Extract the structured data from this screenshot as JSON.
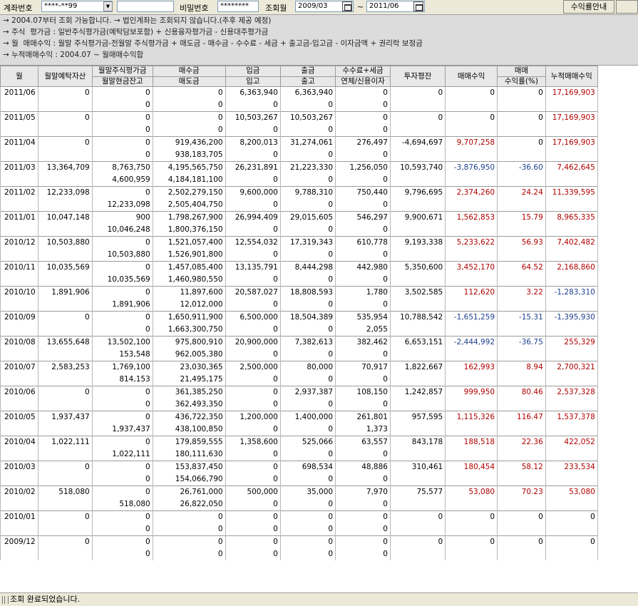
{
  "toolbar": {
    "account_label": "계좌번호",
    "account_value": "****-**99",
    "account_name_value": "",
    "password_label": "비밀번호",
    "password_value": "********",
    "query_month_label": "조회월",
    "from_month": "2009/03",
    "range_sep": "~",
    "to_month": "2011/06",
    "guide_button": "수익률안내"
  },
  "info_lines": [
    "→ 2004.07부터 조회 가능합니다. → 법인계좌는 조회되지 않습니다.(추후 제공 예정)",
    "→ 주식  평가금 : 일반주식평가금(예탁담보포함) + 신용융자평가금 - 신용대주평가금",
    "→ 월  매매수익 : 월말 주식평가금-전월말 주식평가금 + 매도금 - 매수금 - 수수료 - 세금 + 출고금-입고금 - 이자금액 + 권리락 보정금",
    "→ 누적매매수익 : 2004.07 ~ 월매매수익합"
  ],
  "columns": {
    "month": "월",
    "deposit": "월말예탁자산",
    "stock_eval_top": "월말주식평가금",
    "stock_eval_bottom": "월말현금잔고",
    "buy_top": "매수금",
    "buy_bottom": "매도금",
    "in_top": "입금",
    "in_bottom": "입고",
    "out_top": "출금",
    "out_bottom": "출고",
    "fee_top": "수수료+세금",
    "fee_bottom": "연체/신용이자",
    "avg_invest": "투자평잔",
    "trade_profit": "매매수익",
    "rate_top": "매매",
    "rate_bottom": "수익률(%)",
    "cum_profit": "누적매매수익"
  },
  "rows": [
    {
      "month": "2011/06",
      "deposit": "0",
      "stock_eval": "0",
      "cash": "0",
      "buy": "0",
      "sell": "0",
      "deposit_in": "6,363,940",
      "stock_in": "0",
      "withdraw": "6,363,940",
      "stock_out": "0",
      "fee": "0",
      "interest": "0",
      "avg_invest": "0",
      "profit": "0",
      "rate": "0",
      "cum": "17,169,903",
      "profit_color": "black",
      "rate_color": "black",
      "cum_color": "red"
    },
    {
      "month": "2011/05",
      "deposit": "0",
      "stock_eval": "0",
      "cash": "0",
      "buy": "0",
      "sell": "0",
      "deposit_in": "10,503,267",
      "stock_in": "0",
      "withdraw": "10,503,267",
      "stock_out": "0",
      "fee": "0",
      "interest": "0",
      "avg_invest": "0",
      "profit": "0",
      "rate": "0",
      "cum": "17,169,903",
      "profit_color": "black",
      "rate_color": "black",
      "cum_color": "red"
    },
    {
      "month": "2011/04",
      "deposit": "0",
      "stock_eval": "0",
      "cash": "0",
      "buy": "919,436,200",
      "sell": "938,183,705",
      "deposit_in": "8,200,013",
      "stock_in": "0",
      "withdraw": "31,274,061",
      "stock_out": "0",
      "fee": "276,497",
      "interest": "0",
      "avg_invest": "-4,694,697",
      "profit": "9,707,258",
      "rate": "0",
      "cum": "17,169,903",
      "profit_color": "red",
      "rate_color": "black",
      "cum_color": "red"
    },
    {
      "month": "2011/03",
      "deposit": "13,364,709",
      "stock_eval": "8,763,750",
      "cash": "4,600,959",
      "buy": "4,195,565,750",
      "sell": "4,184,181,100",
      "deposit_in": "26,231,891",
      "stock_in": "0",
      "withdraw": "21,223,330",
      "stock_out": "0",
      "fee": "1,256,050",
      "interest": "0",
      "avg_invest": "10,593,740",
      "profit": "-3,876,950",
      "rate": "-36.60",
      "cum": "7,462,645",
      "profit_color": "blue",
      "rate_color": "blue",
      "cum_color": "red"
    },
    {
      "month": "2011/02",
      "deposit": "12,233,098",
      "stock_eval": "0",
      "cash": "12,233,098",
      "buy": "2,502,279,150",
      "sell": "2,505,404,750",
      "deposit_in": "9,600,000",
      "stock_in": "0",
      "withdraw": "9,788,310",
      "stock_out": "0",
      "fee": "750,440",
      "interest": "0",
      "avg_invest": "9,796,695",
      "profit": "2,374,260",
      "rate": "24.24",
      "cum": "11,339,595",
      "profit_color": "red",
      "rate_color": "red",
      "cum_color": "red"
    },
    {
      "month": "2011/01",
      "deposit": "10,047,148",
      "stock_eval": "900",
      "cash": "10,046,248",
      "buy": "1,798,267,900",
      "sell": "1,800,376,150",
      "deposit_in": "26,994,409",
      "stock_in": "0",
      "withdraw": "29,015,605",
      "stock_out": "0",
      "fee": "546,297",
      "interest": "0",
      "avg_invest": "9,900,671",
      "profit": "1,562,853",
      "rate": "15.79",
      "cum": "8,965,335",
      "profit_color": "red",
      "rate_color": "red",
      "cum_color": "red"
    },
    {
      "month": "2010/12",
      "deposit": "10,503,880",
      "stock_eval": "0",
      "cash": "10,503,880",
      "buy": "1,521,057,400",
      "sell": "1,526,901,800",
      "deposit_in": "12,554,032",
      "stock_in": "0",
      "withdraw": "17,319,343",
      "stock_out": "0",
      "fee": "610,778",
      "interest": "0",
      "avg_invest": "9,193,338",
      "profit": "5,233,622",
      "rate": "56.93",
      "cum": "7,402,482",
      "profit_color": "red",
      "rate_color": "red",
      "cum_color": "red"
    },
    {
      "month": "2010/11",
      "deposit": "10,035,569",
      "stock_eval": "0",
      "cash": "10,035,569",
      "buy": "1,457,085,400",
      "sell": "1,460,980,550",
      "deposit_in": "13,135,791",
      "stock_in": "0",
      "withdraw": "8,444,298",
      "stock_out": "0",
      "fee": "442,980",
      "interest": "0",
      "avg_invest": "5,350,600",
      "profit": "3,452,170",
      "rate": "64.52",
      "cum": "2,168,860",
      "profit_color": "red",
      "rate_color": "red",
      "cum_color": "red"
    },
    {
      "month": "2010/10",
      "deposit": "1,891,906",
      "stock_eval": "0",
      "cash": "1,891,906",
      "buy": "11,897,600",
      "sell": "12,012,000",
      "deposit_in": "20,587,027",
      "stock_in": "0",
      "withdraw": "18,808,593",
      "stock_out": "0",
      "fee": "1,780",
      "interest": "0",
      "avg_invest": "3,502,585",
      "profit": "112,620",
      "rate": "3.22",
      "cum": "-1,283,310",
      "profit_color": "red",
      "rate_color": "red",
      "cum_color": "blue"
    },
    {
      "month": "2010/09",
      "deposit": "0",
      "stock_eval": "0",
      "cash": "0",
      "buy": "1,650,911,900",
      "sell": "1,663,300,750",
      "deposit_in": "6,500,000",
      "stock_in": "0",
      "withdraw": "18,504,389",
      "stock_out": "0",
      "fee": "535,954",
      "interest": "2,055",
      "avg_invest": "10,788,542",
      "profit": "-1,651,259",
      "rate": "-15.31",
      "cum": "-1,395,930",
      "profit_color": "blue",
      "rate_color": "blue",
      "cum_color": "blue"
    },
    {
      "month": "2010/08",
      "deposit": "13,655,648",
      "stock_eval": "13,502,100",
      "cash": "153,548",
      "buy": "975,800,910",
      "sell": "962,005,380",
      "deposit_in": "20,900,000",
      "stock_in": "0",
      "withdraw": "7,382,613",
      "stock_out": "0",
      "fee": "382,462",
      "interest": "0",
      "avg_invest": "6,653,151",
      "profit": "-2,444,992",
      "rate": "-36.75",
      "cum": "255,329",
      "profit_color": "blue",
      "rate_color": "blue",
      "cum_color": "red"
    },
    {
      "month": "2010/07",
      "deposit": "2,583,253",
      "stock_eval": "1,769,100",
      "cash": "814,153",
      "buy": "23,030,365",
      "sell": "21,495,175",
      "deposit_in": "2,500,000",
      "stock_in": "0",
      "withdraw": "80,000",
      "stock_out": "0",
      "fee": "70,917",
      "interest": "0",
      "avg_invest": "1,822,667",
      "profit": "162,993",
      "rate": "8.94",
      "cum": "2,700,321",
      "profit_color": "red",
      "rate_color": "red",
      "cum_color": "red"
    },
    {
      "month": "2010/06",
      "deposit": "0",
      "stock_eval": "0",
      "cash": "0",
      "buy": "361,385,250",
      "sell": "362,493,350",
      "deposit_in": "0",
      "stock_in": "0",
      "withdraw": "2,937,387",
      "stock_out": "0",
      "fee": "108,150",
      "interest": "0",
      "avg_invest": "1,242,857",
      "profit": "999,950",
      "rate": "80.46",
      "cum": "2,537,328",
      "profit_color": "red",
      "rate_color": "red",
      "cum_color": "red"
    },
    {
      "month": "2010/05",
      "deposit": "1,937,437",
      "stock_eval": "0",
      "cash": "1,937,437",
      "buy": "436,722,350",
      "sell": "438,100,850",
      "deposit_in": "1,200,000",
      "stock_in": "0",
      "withdraw": "1,400,000",
      "stock_out": "0",
      "fee": "261,801",
      "interest": "1,373",
      "avg_invest": "957,595",
      "profit": "1,115,326",
      "rate": "116.47",
      "cum": "1,537,378",
      "profit_color": "red",
      "rate_color": "red",
      "cum_color": "red"
    },
    {
      "month": "2010/04",
      "deposit": "1,022,111",
      "stock_eval": "0",
      "cash": "1,022,111",
      "buy": "179,859,555",
      "sell": "180,111,630",
      "deposit_in": "1,358,600",
      "stock_in": "0",
      "withdraw": "525,066",
      "stock_out": "0",
      "fee": "63,557",
      "interest": "0",
      "avg_invest": "843,178",
      "profit": "188,518",
      "rate": "22.36",
      "cum": "422,052",
      "profit_color": "red",
      "rate_color": "red",
      "cum_color": "red"
    },
    {
      "month": "2010/03",
      "deposit": "0",
      "stock_eval": "0",
      "cash": "0",
      "buy": "153,837,450",
      "sell": "154,066,790",
      "deposit_in": "0",
      "stock_in": "0",
      "withdraw": "698,534",
      "stock_out": "0",
      "fee": "48,886",
      "interest": "0",
      "avg_invest": "310,461",
      "profit": "180,454",
      "rate": "58.12",
      "cum": "233,534",
      "profit_color": "red",
      "rate_color": "red",
      "cum_color": "red"
    },
    {
      "month": "2010/02",
      "deposit": "518,080",
      "stock_eval": "0",
      "cash": "518,080",
      "buy": "26,761,000",
      "sell": "26,822,050",
      "deposit_in": "500,000",
      "stock_in": "0",
      "withdraw": "35,000",
      "stock_out": "0",
      "fee": "7,970",
      "interest": "0",
      "avg_invest": "75,577",
      "profit": "53,080",
      "rate": "70.23",
      "cum": "53,080",
      "profit_color": "red",
      "rate_color": "red",
      "cum_color": "red"
    },
    {
      "month": "2010/01",
      "deposit": "0",
      "stock_eval": "0",
      "cash": "0",
      "buy": "0",
      "sell": "0",
      "deposit_in": "0",
      "stock_in": "0",
      "withdraw": "0",
      "stock_out": "0",
      "fee": "0",
      "interest": "0",
      "avg_invest": "0",
      "profit": "0",
      "rate": "0",
      "cum": "0",
      "profit_color": "black",
      "rate_color": "black",
      "cum_color": "black"
    },
    {
      "month": "2009/12",
      "deposit": "0",
      "stock_eval": "0",
      "cash": "0",
      "buy": "0",
      "sell": "0",
      "deposit_in": "0",
      "stock_in": "0",
      "withdraw": "0",
      "stock_out": "0",
      "fee": "0",
      "interest": "0",
      "avg_invest": "0",
      "profit": "0",
      "rate": "0",
      "cum": "0",
      "profit_color": "black",
      "rate_color": "black",
      "cum_color": "black"
    }
  ],
  "status": {
    "message": "조회 완료되었습니다."
  }
}
